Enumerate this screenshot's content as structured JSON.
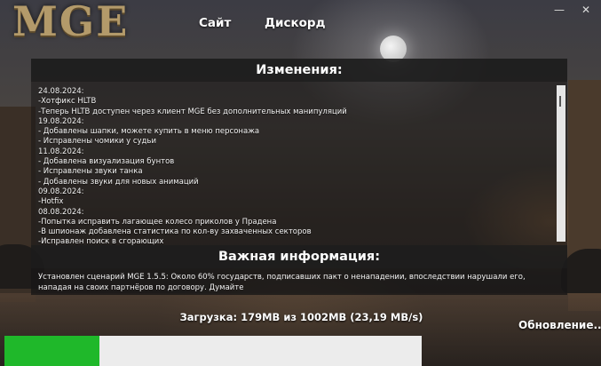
{
  "app": {
    "logo_text": "MGE",
    "nav": {
      "site": "Сайт",
      "discord": "Дискорд"
    },
    "window_controls": {
      "minimize": "—",
      "close": "✕"
    }
  },
  "changes": {
    "title": "Изменения:",
    "text": "24.08.2024:\n-Хотфикс HLTB\n-Теперь HLTB доступен через клиент MGE без дополнительных манипуляций\n19.08.2024:\n- Добавлены шапки, можете купить в меню персонажа\n- Исправлены чомики у судьи\n11.08.2024:\n- Добавлена визуализация бунтов\n- Исправлены звуки танка\n- Добавлены звуки для новых анимаций\n09.08.2024:\n-Hotfix\n08.08.2024:\n-Попытка исправить лагающее колесо приколов у Прадена\n-В шпионаж добавлена статистика по кол-ву захваченных секторов\n-Исправлен поиск в сгорающих"
  },
  "info": {
    "title": "Важная информация:",
    "text": "Установлен сценарий MGE 1.5.5: Около 60% государств, подписавших пакт о ненападении, впоследствии нарушали его, нападая на своих партнёров по договору. Думайте"
  },
  "download": {
    "status": "Загрузка: 179MB из 1002MB  (23,19 MB/s)",
    "update_label": "Обновление...",
    "progress_fraction": 0.2275,
    "fill_color": "#1fb82a",
    "track_color": "#ececec"
  }
}
